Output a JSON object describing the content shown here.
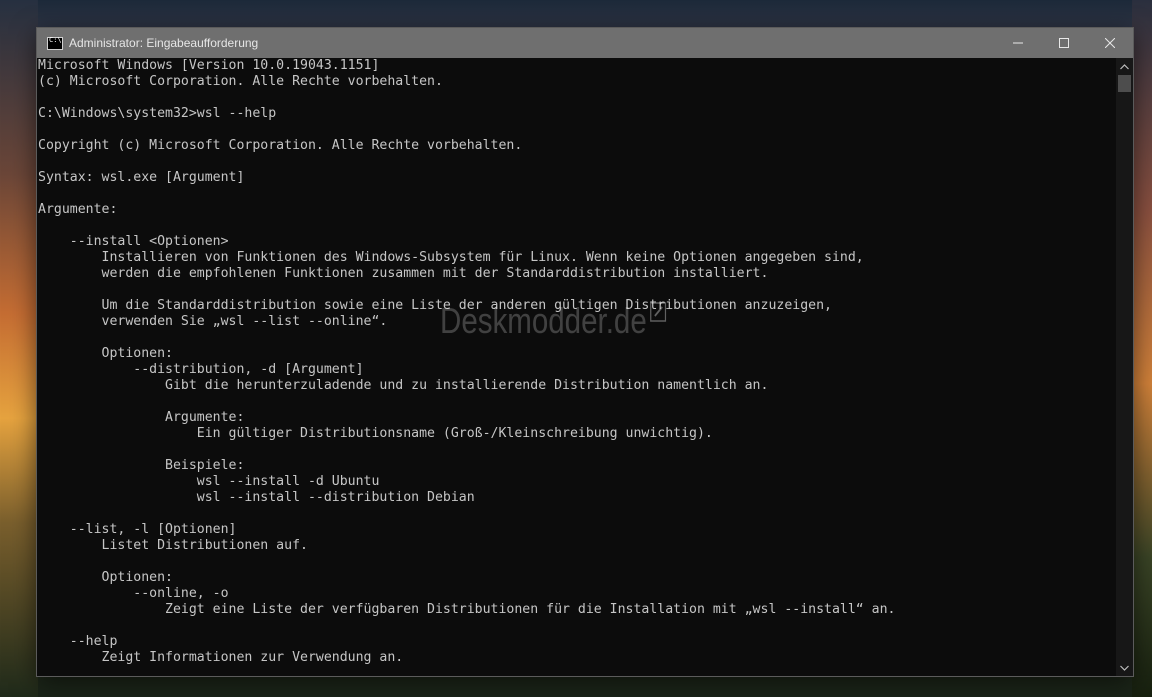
{
  "window": {
    "title": "Administrator: Eingabeaufforderung",
    "icon": "cmd-icon",
    "controls": [
      "minimize-icon",
      "maximize-icon",
      "close-icon"
    ]
  },
  "console": {
    "lines": [
      "Microsoft Windows [Version 10.0.19043.1151]",
      "(c) Microsoft Corporation. Alle Rechte vorbehalten.",
      "",
      "C:\\Windows\\system32>wsl --help",
      "",
      "Copyright (c) Microsoft Corporation. Alle Rechte vorbehalten.",
      "",
      "Syntax: wsl.exe [Argument]",
      "",
      "Argumente:",
      "",
      "    --install <Optionen>",
      "        Installieren von Funktionen des Windows-Subsystem für Linux. Wenn keine Optionen angegeben sind,",
      "        werden die empfohlenen Funktionen zusammen mit der Standarddistribution installiert.",
      "",
      "        Um die Standarddistribution sowie eine Liste der anderen gültigen Distributionen anzuzeigen,",
      "        verwenden Sie „wsl --list --online“.",
      "",
      "        Optionen:",
      "            --distribution, -d [Argument]",
      "                Gibt die herunterzuladende und zu installierende Distribution namentlich an.",
      "",
      "                Argumente:",
      "                    Ein gültiger Distributionsname (Groß-/Kleinschreibung unwichtig).",
      "",
      "                Beispiele:",
      "                    wsl --install -d Ubuntu",
      "                    wsl --install --distribution Debian",
      "",
      "    --list, -l [Optionen]",
      "        Listet Distributionen auf.",
      "",
      "        Optionen:",
      "            --online, -o",
      "                Zeigt eine Liste der verfügbaren Distributionen für die Installation mit „wsl --install“ an.",
      "",
      "    --help",
      "        Zeigt Informationen zur Verwendung an."
    ]
  },
  "watermark": {
    "text": "Deskmodder.de",
    "icon": "pencil-icon"
  },
  "colors": {
    "console_bg": "#0c0c0c",
    "console_fg": "#c6c6c6",
    "titlebar_bg": "#6f6f6f"
  }
}
